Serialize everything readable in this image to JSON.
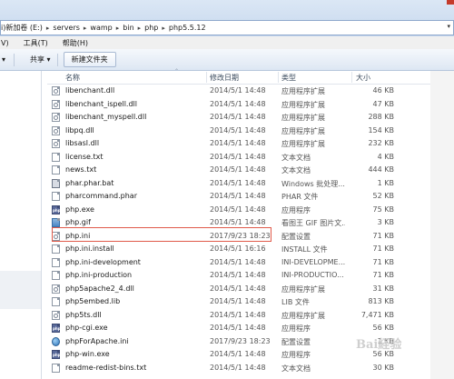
{
  "address": {
    "prefix": "i)",
    "crumbs": [
      "新加卷 (E:)",
      "servers",
      "wamp",
      "bin",
      "php",
      "php5.5.12"
    ],
    "tail": "▾"
  },
  "menu": [
    "V)",
    "工具(T)",
    "帮助(H)"
  ],
  "toolbar": {
    "organize_tail": "▾",
    "share_label": "共享 ▾",
    "new_folder_label": "新建文件夹"
  },
  "columns": {
    "name": "名称",
    "date": "修改日期",
    "type": "类型",
    "size": "大小"
  },
  "files": [
    {
      "icon": "gear-file",
      "name": "libenchant.dll",
      "date": "2014/5/1 14:48",
      "type": "应用程序扩展",
      "size": "46 KB"
    },
    {
      "icon": "gear-file",
      "name": "libenchant_ispell.dll",
      "date": "2014/5/1 14:48",
      "type": "应用程序扩展",
      "size": "47 KB"
    },
    {
      "icon": "gear-file",
      "name": "libenchant_myspell.dll",
      "date": "2014/5/1 14:48",
      "type": "应用程序扩展",
      "size": "288 KB"
    },
    {
      "icon": "gear-file",
      "name": "libpq.dll",
      "date": "2014/5/1 14:48",
      "type": "应用程序扩展",
      "size": "154 KB"
    },
    {
      "icon": "gear-file",
      "name": "libsasl.dll",
      "date": "2014/5/1 14:48",
      "type": "应用程序扩展",
      "size": "232 KB"
    },
    {
      "icon": "text-file",
      "name": "license.txt",
      "date": "2014/5/1 14:48",
      "type": "文本文档",
      "size": "4 KB"
    },
    {
      "icon": "text-file",
      "name": "news.txt",
      "date": "2014/5/1 14:48",
      "type": "文本文档",
      "size": "444 KB"
    },
    {
      "icon": "bat-file",
      "name": "phar.phar.bat",
      "date": "2014/5/1 14:48",
      "type": "Windows 批处理...",
      "size": "1 KB"
    },
    {
      "icon": "text-file",
      "name": "pharcommand.phar",
      "date": "2014/5/1 14:48",
      "type": "PHAR 文件",
      "size": "52 KB"
    },
    {
      "icon": "php-file",
      "name": "php.exe",
      "date": "2014/5/1 14:48",
      "type": "应用程序",
      "size": "75 KB"
    },
    {
      "icon": "image-file",
      "name": "php.gif",
      "date": "2014/5/1 14:48",
      "type": "看图王 GIF 图片文...",
      "size": "3 KB"
    },
    {
      "icon": "gear-file",
      "name": "php.ini",
      "date": "2017/9/23 18:23",
      "type": "配置设置",
      "size": "71 KB"
    },
    {
      "icon": "text-file",
      "name": "php.ini.install",
      "date": "2014/5/1 16:16",
      "type": "INSTALL 文件",
      "size": "71 KB"
    },
    {
      "icon": "text-file",
      "name": "php.ini-development",
      "date": "2014/5/1 14:48",
      "type": "INI-DEVELOPME...",
      "size": "71 KB"
    },
    {
      "icon": "text-file",
      "name": "php.ini-production",
      "date": "2014/5/1 14:48",
      "type": "INI-PRODUCTIO...",
      "size": "71 KB"
    },
    {
      "icon": "gear-file",
      "name": "php5apache2_4.dll",
      "date": "2014/5/1 14:48",
      "type": "应用程序扩展",
      "size": "31 KB"
    },
    {
      "icon": "text-file",
      "name": "php5embed.lib",
      "date": "2014/5/1 14:48",
      "type": "LIB 文件",
      "size": "813 KB"
    },
    {
      "icon": "gear-file",
      "name": "php5ts.dll",
      "date": "2014/5/1 14:48",
      "type": "应用程序扩展",
      "size": "7,471 KB"
    },
    {
      "icon": "php-file",
      "name": "php-cgi.exe",
      "date": "2014/5/1 14:48",
      "type": "应用程序",
      "size": "56 KB"
    },
    {
      "icon": "globe-file",
      "name": "phpForApache.ini",
      "date": "2017/9/23 18:23",
      "type": "配置设置",
      "size": "1 KB"
    },
    {
      "icon": "php-file",
      "name": "php-win.exe",
      "date": "2014/5/1 14:48",
      "type": "应用程序",
      "size": "56 KB"
    },
    {
      "icon": "text-file",
      "name": "readme-redist-bins.txt",
      "date": "2014/5/1 14:48",
      "type": "文本文档",
      "size": "30 KB"
    }
  ],
  "watermark": "Bai経验"
}
